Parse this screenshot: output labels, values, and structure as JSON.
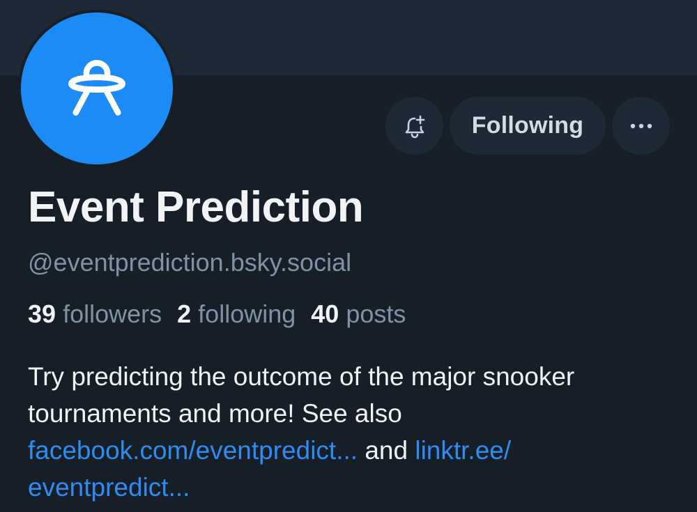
{
  "profile": {
    "display_name": "Event Prediction",
    "handle": "@eventprediction.bsky.social",
    "avatar_icon": "ufo-icon",
    "avatar_color": "#1c8bf5"
  },
  "actions": {
    "bell_icon": "bell-plus-icon",
    "follow_label": "Following",
    "more_icon": "ellipsis-icon",
    "more_label": "•••"
  },
  "stats": {
    "followers_count": "39",
    "followers_label": "followers",
    "following_count": "2",
    "following_label": "following",
    "posts_count": "40",
    "posts_label": "posts"
  },
  "bio": {
    "line1": "Try predicting the outcome of the major snooker tournaments and more! See also ",
    "link1": "facebook.com/eventpredict...",
    "middle": " and ",
    "link2_part1": "linktr.ee/",
    "link2_part2": "eventpredict..."
  },
  "colors": {
    "background": "#161e27",
    "banner": "#1e2935",
    "link": "#2f8cf0",
    "muted": "#8093a6"
  }
}
